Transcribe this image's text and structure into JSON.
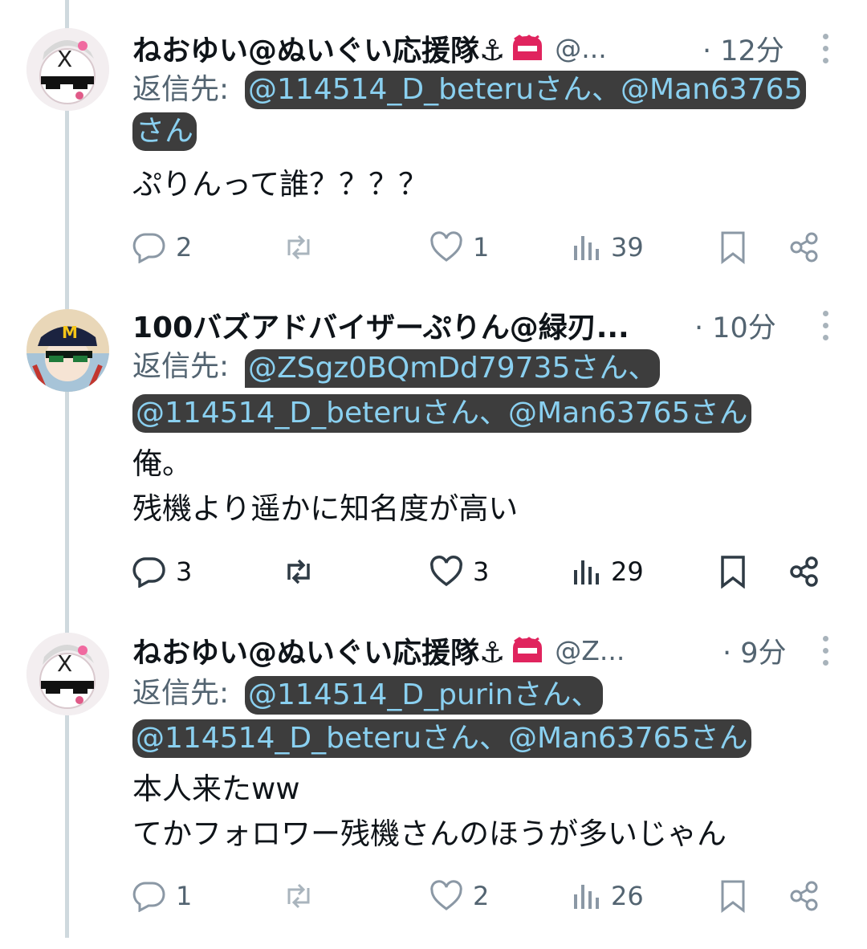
{
  "tweets": [
    {
      "name": "ねおゆい@ぬいぐい応援隊⚓",
      "handle": "@...",
      "time": "· 12分",
      "reply_label": "返信先:",
      "mention_lines": [
        "@114514_D_beteruさん、@Man63765",
        "さん"
      ],
      "text": "ぷりんって誰？？？？",
      "replies": "2",
      "likes": "1",
      "views": "39"
    },
    {
      "name": "100バズアドバイザーぷりん@緑刃...",
      "handle": "",
      "time": "· 10分",
      "reply_label": "返信先:",
      "mention_lines": [
        "@ZSgz0BQmDd79735さん、",
        "@114514_D_beteruさん、@Man63765さん"
      ],
      "text": "俺。\n残機より遥かに知名度が高い",
      "replies": "3",
      "likes": "3",
      "views": "29"
    },
    {
      "name": "ねおゆい@ぬいぐい応援隊⚓",
      "handle": "@Z...",
      "time": "· 9分",
      "reply_label": "返信先:",
      "mention_lines": [
        "@114514_D_purinさん、",
        "@114514_D_beteruさん、@Man63765さん"
      ],
      "text": "本人来たww\nてかフォロワー残機さんのほうが多いじゃん",
      "replies": "1",
      "likes": "2",
      "views": "26"
    }
  ],
  "icons": [
    "reply-icon",
    "retweet-icon",
    "like-icon",
    "views-icon",
    "bookmark-icon",
    "share-icon",
    "more-icon"
  ],
  "colors": {
    "mention_text": "#8ad0f0",
    "mention_bg": "#3d3d3d",
    "muted": "#536471",
    "thread_line": "#cfd9de"
  }
}
